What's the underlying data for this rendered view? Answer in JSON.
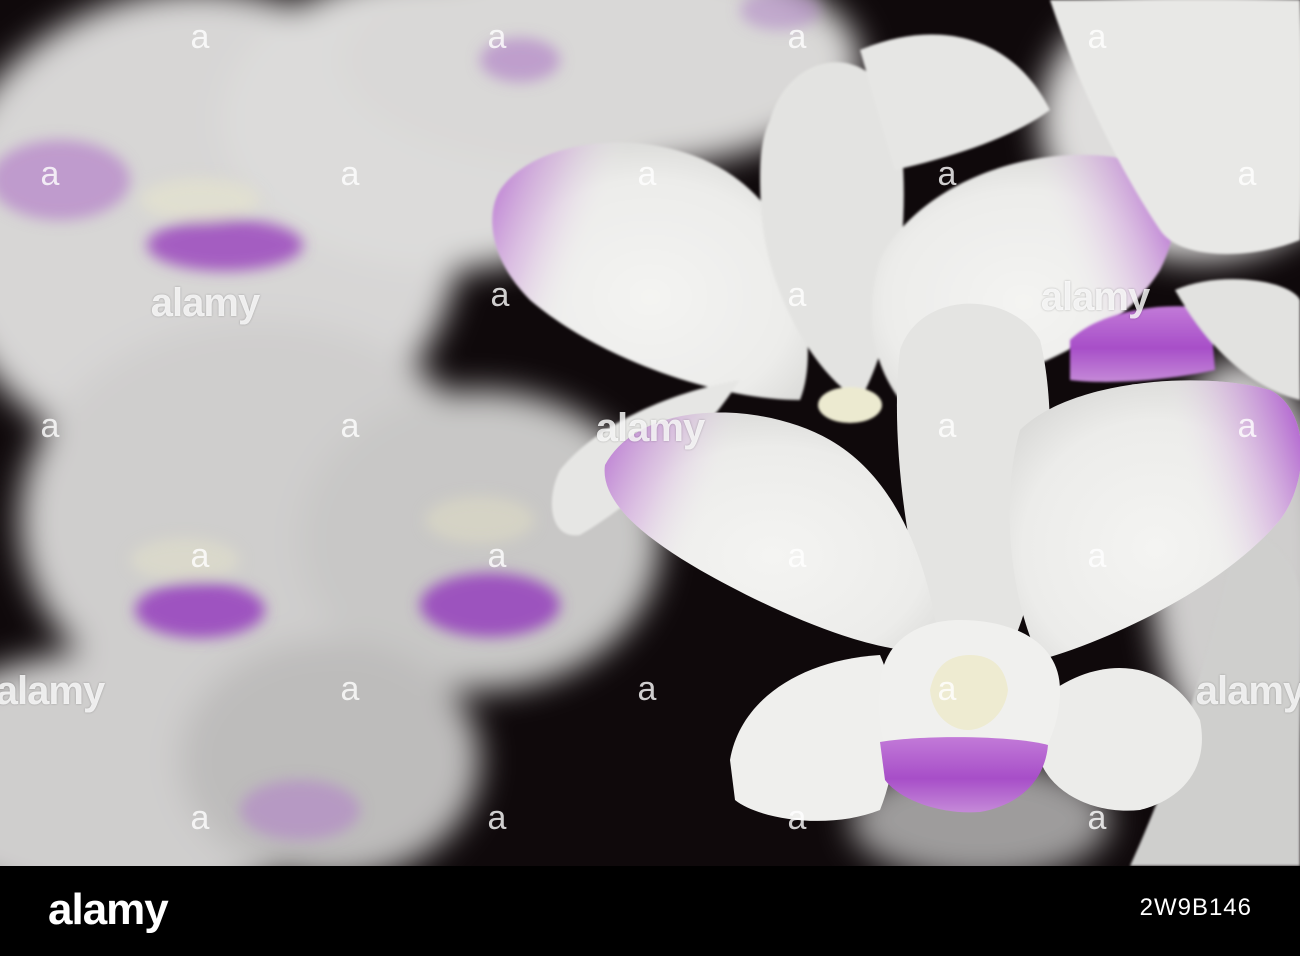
{
  "photo": {
    "subject": "white-orchids-with-purple-tips",
    "colors": {
      "petal": "#f1f1ef",
      "petal_shade": "#d9d9d8",
      "tip": "#b86fd0",
      "lip": "#a74ec8",
      "column": "#ece9cf",
      "background": "#0f090b"
    }
  },
  "watermark": {
    "word": "alamy",
    "dot": "a"
  },
  "footer": {
    "brand": "alamy",
    "image_id": "2W9B146"
  }
}
